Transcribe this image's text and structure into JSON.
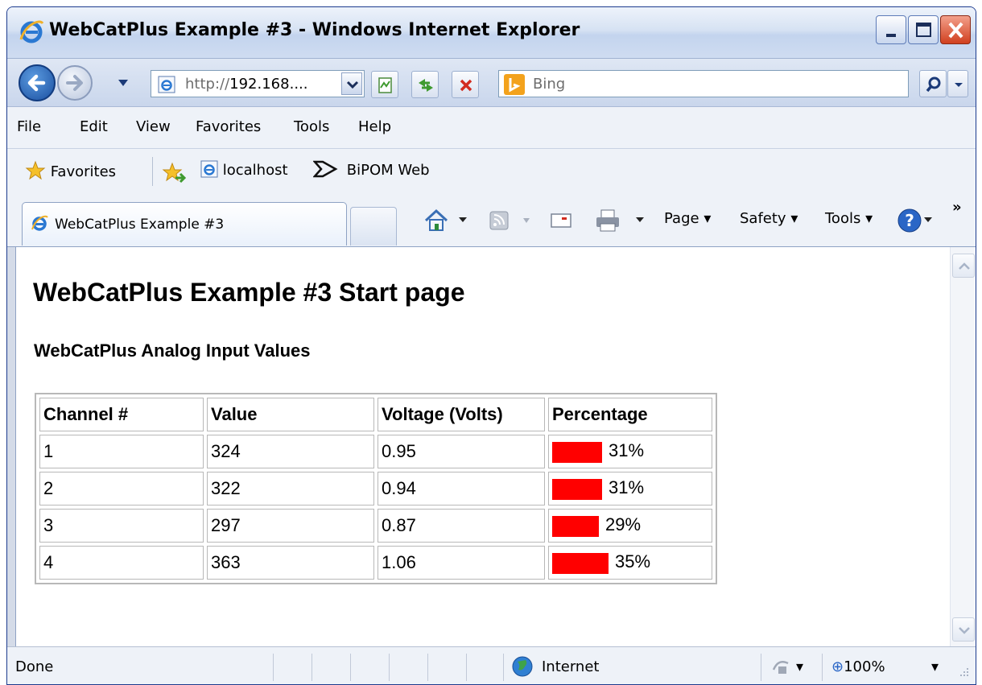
{
  "window": {
    "title": "WebCatPlus Example #3 - Windows Internet Explorer"
  },
  "address": {
    "url_prefix": "http://",
    "url_rest": "192.168....",
    "search_placeholder": "Bing"
  },
  "menu": {
    "items": [
      "File",
      "Edit",
      "View",
      "Favorites",
      "Tools",
      "Help"
    ]
  },
  "favorites_bar": {
    "favorites_label": "Favorites",
    "links": [
      "localhost",
      "BiPOM Web"
    ]
  },
  "tabs": {
    "active_label": "WebCatPlus Example #3"
  },
  "command_bar": {
    "page": "Page",
    "safety": "Safety",
    "tools": "Tools",
    "overflow": "»"
  },
  "page": {
    "heading": "WebCatPlus Example #3 Start page",
    "subheading": "WebCatPlus Analog Input Values",
    "table": {
      "headers": [
        "Channel #",
        "Value",
        "Voltage (Volts)",
        "Percentage"
      ],
      "rows": [
        {
          "channel": "1",
          "value": "324",
          "voltage": "0.95",
          "percentage": "31%",
          "fraction": 0.31
        },
        {
          "channel": "2",
          "value": "322",
          "voltage": "0.94",
          "percentage": "31%",
          "fraction": 0.31
        },
        {
          "channel": "3",
          "value": "297",
          "voltage": "0.87",
          "percentage": "29%",
          "fraction": 0.29
        },
        {
          "channel": "4",
          "value": "363",
          "voltage": "1.06",
          "percentage": "35%",
          "fraction": 0.35
        }
      ]
    },
    "bar_color": "#ff0000"
  },
  "status": {
    "text": "Done",
    "zone": "Internet",
    "zoom": "100%"
  },
  "colors": {
    "title_bar": "#d6e2f3",
    "close_button": "#d1401f",
    "bing": "#f3a21c"
  }
}
